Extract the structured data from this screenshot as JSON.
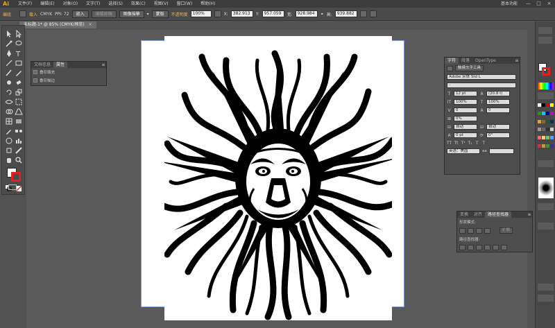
{
  "app": {
    "logo": "Ai",
    "workspace": "基本功能"
  },
  "menu": [
    "文件(F)",
    "编辑(E)",
    "对象(O)",
    "文字(T)",
    "选择(S)",
    "效果(C)",
    "视图(V)",
    "窗口(W)",
    "帮助(H)"
  ],
  "window_controls": [
    "—",
    "□",
    "×"
  ],
  "control_bar": {
    "group_label": "编组",
    "mode_label": "载入",
    "color_mode": "CMYK",
    "ppi_label": "PPI: 72",
    "embed_button": "嵌入",
    "edit_original_button": "编辑原稿",
    "image_trace_button": "图像描摹",
    "mask_button": "蒙版",
    "opacity_label": "不透明度",
    "opacity_value": "100%",
    "x_label": "X:",
    "x_value": "382.913",
    "y_label": "Y:",
    "y_value": "957.059",
    "w_label": "宽:",
    "w_value": "928.984",
    "h_label": "高:",
    "h_value": "939.882"
  },
  "document_tab": {
    "title": "未标题-1* @ 85% (CMYK/预览)",
    "close": "×"
  },
  "attributes_panel": {
    "tabs": [
      "文档信息",
      "属性"
    ],
    "overprint_fill": "叠印填充",
    "overprint_stroke": "叠印描边"
  },
  "character_panel": {
    "tabs": [
      "字符",
      "段落",
      "OpenType"
    ],
    "touch_type_button": "触摸文字工具",
    "font_family": "Adobe 宋体 Std L",
    "font_style": "-",
    "font_size": "12 pt",
    "leading": "(20.8 t)",
    "vertical_scale": "100%",
    "horizontal_scale": "100%",
    "kerning": "0",
    "tracking": "0",
    "rotation": "0%",
    "auto_1": "自动",
    "auto_2": "自动",
    "baseline_shift": "0 pt",
    "char_rotation": "0°",
    "language": "英语：美国",
    "aa": "aa"
  },
  "pathfinder_panel": {
    "tabs": [
      "变换",
      "对齐",
      "路径查找器"
    ],
    "shape_modes_label": "形状模式:",
    "expand_button": "扩展",
    "pathfinders_label": "路径查找器:"
  },
  "colors": {
    "accent": "#f7a21b",
    "artboard": "#ffffff",
    "canvas": "#5a5a5a",
    "ui_dark": "#3c3c3c"
  }
}
